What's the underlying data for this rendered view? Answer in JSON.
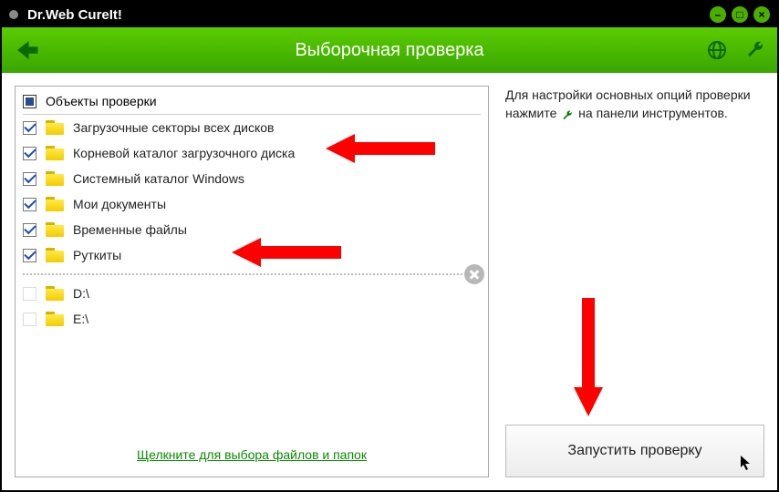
{
  "window": {
    "title": "Dr.Web CureIt!"
  },
  "toolbar": {
    "page_title": "Выборочная проверка"
  },
  "list": {
    "header_label": "Объекты проверки",
    "items": [
      {
        "label": "Загрузочные секторы всех дисков",
        "checked": true
      },
      {
        "label": "Корневой каталог загрузочного диска",
        "checked": true
      },
      {
        "label": "Системный каталог Windows",
        "checked": true
      },
      {
        "label": "Мои документы",
        "checked": true
      },
      {
        "label": "Временные файлы",
        "checked": true
      },
      {
        "label": "Руткиты",
        "checked": true
      }
    ],
    "drives": [
      {
        "label": "D:\\",
        "checked": false
      },
      {
        "label": "E:\\",
        "checked": false
      }
    ]
  },
  "select_link": "Щелкните для выбора файлов и папок",
  "info": {
    "part1": "Для настройки основных опций проверки нажмите ",
    "part2": " на панели инструментов."
  },
  "start_button": "Запустить проверку"
}
